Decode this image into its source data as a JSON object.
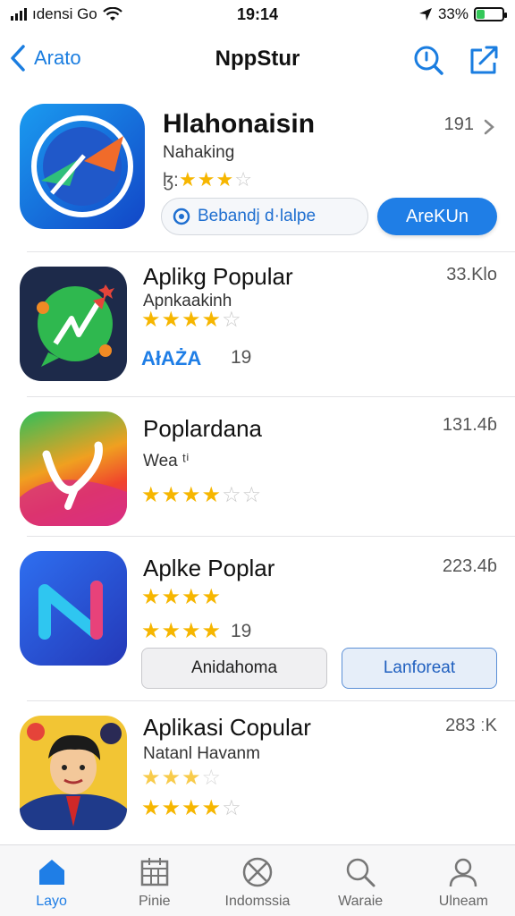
{
  "status_bar": {
    "carrier": "ıdensi Go",
    "time": "19:14",
    "battery": "33%",
    "battery_level": 0.33
  },
  "nav": {
    "back_label": "Arato",
    "title": "NppStur"
  },
  "featured": {
    "name": "Hlahonaisin",
    "subtitle": "Nahaking",
    "rating_text": "ɮ:",
    "size": "191",
    "secondary_button": "Bebandj d·lalpe",
    "primary_button": "AreKUn",
    "rating": 2.5
  },
  "apps": [
    {
      "name": "Aplikg Popular",
      "subtitle": "Apnkaakinh",
      "size": "33.Klo",
      "badge": "AłAŻA",
      "count": "19",
      "rating": 4.0
    },
    {
      "name": "Poplardana",
      "subtitle": "Wea ᵗⁱ",
      "size": "131.4ɓ",
      "rating": 3.5
    },
    {
      "name": "Aplke Poplar",
      "size": "223.4ɓ",
      "count": "19",
      "button_left": "Anidahoma",
      "button_right": "Lanforeat",
      "rating": 4.0
    },
    {
      "name": "Aplikasi Copular",
      "subtitle": "Natanl Havanm",
      "size": "283 ːK",
      "rating": 4.0
    }
  ],
  "tabs": [
    {
      "label": "Layo",
      "icon": "home-icon"
    },
    {
      "label": "Pinie",
      "icon": "calendar-icon"
    },
    {
      "label": "Indomssia",
      "icon": "circle-x-icon"
    },
    {
      "label": "Waraie",
      "icon": "search-icon"
    },
    {
      "label": "Ulneam",
      "icon": "person-icon"
    }
  ],
  "colors": {
    "accent": "#1f7ee6",
    "star": "#f6b600",
    "battery": "#34c759"
  }
}
